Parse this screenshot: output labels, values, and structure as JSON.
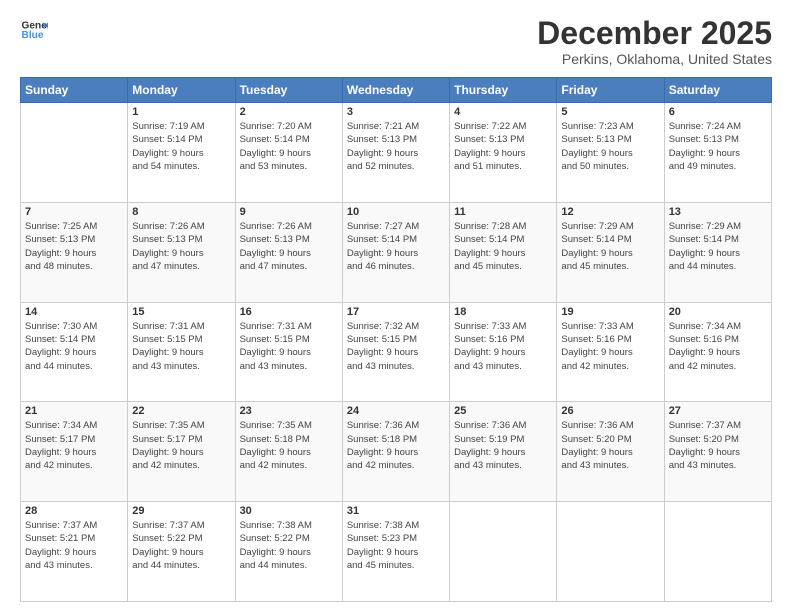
{
  "logo": {
    "line1": "General",
    "line2": "Blue"
  },
  "header": {
    "title": "December 2025",
    "subtitle": "Perkins, Oklahoma, United States"
  },
  "weekdays": [
    "Sunday",
    "Monday",
    "Tuesday",
    "Wednesday",
    "Thursday",
    "Friday",
    "Saturday"
  ],
  "weeks": [
    [
      {
        "day": "",
        "info": ""
      },
      {
        "day": "1",
        "info": "Sunrise: 7:19 AM\nSunset: 5:14 PM\nDaylight: 9 hours\nand 54 minutes."
      },
      {
        "day": "2",
        "info": "Sunrise: 7:20 AM\nSunset: 5:14 PM\nDaylight: 9 hours\nand 53 minutes."
      },
      {
        "day": "3",
        "info": "Sunrise: 7:21 AM\nSunset: 5:13 PM\nDaylight: 9 hours\nand 52 minutes."
      },
      {
        "day": "4",
        "info": "Sunrise: 7:22 AM\nSunset: 5:13 PM\nDaylight: 9 hours\nand 51 minutes."
      },
      {
        "day": "5",
        "info": "Sunrise: 7:23 AM\nSunset: 5:13 PM\nDaylight: 9 hours\nand 50 minutes."
      },
      {
        "day": "6",
        "info": "Sunrise: 7:24 AM\nSunset: 5:13 PM\nDaylight: 9 hours\nand 49 minutes."
      }
    ],
    [
      {
        "day": "7",
        "info": "Sunrise: 7:25 AM\nSunset: 5:13 PM\nDaylight: 9 hours\nand 48 minutes."
      },
      {
        "day": "8",
        "info": "Sunrise: 7:26 AM\nSunset: 5:13 PM\nDaylight: 9 hours\nand 47 minutes."
      },
      {
        "day": "9",
        "info": "Sunrise: 7:26 AM\nSunset: 5:13 PM\nDaylight: 9 hours\nand 47 minutes."
      },
      {
        "day": "10",
        "info": "Sunrise: 7:27 AM\nSunset: 5:14 PM\nDaylight: 9 hours\nand 46 minutes."
      },
      {
        "day": "11",
        "info": "Sunrise: 7:28 AM\nSunset: 5:14 PM\nDaylight: 9 hours\nand 45 minutes."
      },
      {
        "day": "12",
        "info": "Sunrise: 7:29 AM\nSunset: 5:14 PM\nDaylight: 9 hours\nand 45 minutes."
      },
      {
        "day": "13",
        "info": "Sunrise: 7:29 AM\nSunset: 5:14 PM\nDaylight: 9 hours\nand 44 minutes."
      }
    ],
    [
      {
        "day": "14",
        "info": "Sunrise: 7:30 AM\nSunset: 5:14 PM\nDaylight: 9 hours\nand 44 minutes."
      },
      {
        "day": "15",
        "info": "Sunrise: 7:31 AM\nSunset: 5:15 PM\nDaylight: 9 hours\nand 43 minutes."
      },
      {
        "day": "16",
        "info": "Sunrise: 7:31 AM\nSunset: 5:15 PM\nDaylight: 9 hours\nand 43 minutes."
      },
      {
        "day": "17",
        "info": "Sunrise: 7:32 AM\nSunset: 5:15 PM\nDaylight: 9 hours\nand 43 minutes."
      },
      {
        "day": "18",
        "info": "Sunrise: 7:33 AM\nSunset: 5:16 PM\nDaylight: 9 hours\nand 43 minutes."
      },
      {
        "day": "19",
        "info": "Sunrise: 7:33 AM\nSunset: 5:16 PM\nDaylight: 9 hours\nand 42 minutes."
      },
      {
        "day": "20",
        "info": "Sunrise: 7:34 AM\nSunset: 5:16 PM\nDaylight: 9 hours\nand 42 minutes."
      }
    ],
    [
      {
        "day": "21",
        "info": "Sunrise: 7:34 AM\nSunset: 5:17 PM\nDaylight: 9 hours\nand 42 minutes."
      },
      {
        "day": "22",
        "info": "Sunrise: 7:35 AM\nSunset: 5:17 PM\nDaylight: 9 hours\nand 42 minutes."
      },
      {
        "day": "23",
        "info": "Sunrise: 7:35 AM\nSunset: 5:18 PM\nDaylight: 9 hours\nand 42 minutes."
      },
      {
        "day": "24",
        "info": "Sunrise: 7:36 AM\nSunset: 5:18 PM\nDaylight: 9 hours\nand 42 minutes."
      },
      {
        "day": "25",
        "info": "Sunrise: 7:36 AM\nSunset: 5:19 PM\nDaylight: 9 hours\nand 43 minutes."
      },
      {
        "day": "26",
        "info": "Sunrise: 7:36 AM\nSunset: 5:20 PM\nDaylight: 9 hours\nand 43 minutes."
      },
      {
        "day": "27",
        "info": "Sunrise: 7:37 AM\nSunset: 5:20 PM\nDaylight: 9 hours\nand 43 minutes."
      }
    ],
    [
      {
        "day": "28",
        "info": "Sunrise: 7:37 AM\nSunset: 5:21 PM\nDaylight: 9 hours\nand 43 minutes."
      },
      {
        "day": "29",
        "info": "Sunrise: 7:37 AM\nSunset: 5:22 PM\nDaylight: 9 hours\nand 44 minutes."
      },
      {
        "day": "30",
        "info": "Sunrise: 7:38 AM\nSunset: 5:22 PM\nDaylight: 9 hours\nand 44 minutes."
      },
      {
        "day": "31",
        "info": "Sunrise: 7:38 AM\nSunset: 5:23 PM\nDaylight: 9 hours\nand 45 minutes."
      },
      {
        "day": "",
        "info": ""
      },
      {
        "day": "",
        "info": ""
      },
      {
        "day": "",
        "info": ""
      }
    ]
  ]
}
